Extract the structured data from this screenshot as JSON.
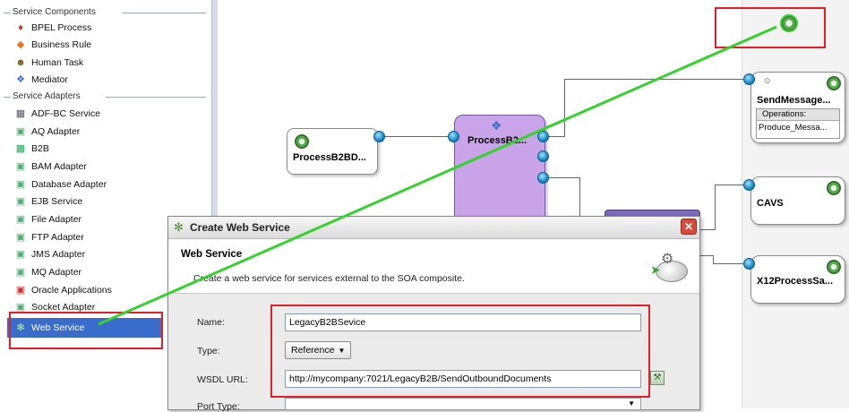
{
  "palette": {
    "service_components_header": "Service Components",
    "service_adapters_header": "Service Adapters",
    "components": [
      {
        "label": "BPEL Process",
        "icon": "bpel-icon"
      },
      {
        "label": "Business Rule",
        "icon": "business-rule-icon"
      },
      {
        "label": "Human Task",
        "icon": "human-task-icon"
      },
      {
        "label": "Mediator",
        "icon": "mediator-icon"
      }
    ],
    "adapters": [
      {
        "label": "ADF-BC Service",
        "icon": "adf-bc-icon"
      },
      {
        "label": "AQ Adapter",
        "icon": "aq-adapter-icon"
      },
      {
        "label": "B2B",
        "icon": "b2b-icon"
      },
      {
        "label": "BAM Adapter",
        "icon": "bam-adapter-icon"
      },
      {
        "label": "Database Adapter",
        "icon": "database-adapter-icon"
      },
      {
        "label": "EJB Service",
        "icon": "ejb-service-icon"
      },
      {
        "label": "File Adapter",
        "icon": "file-adapter-icon"
      },
      {
        "label": "FTP Adapter",
        "icon": "ftp-adapter-icon"
      },
      {
        "label": "JMS Adapter",
        "icon": "jms-adapter-icon"
      },
      {
        "label": "MQ Adapter",
        "icon": "mq-adapter-icon"
      },
      {
        "label": "Oracle Applications",
        "icon": "oracle-apps-icon"
      },
      {
        "label": "Socket Adapter",
        "icon": "socket-adapter-icon"
      },
      {
        "label": "Web Service",
        "icon": "web-service-icon"
      }
    ]
  },
  "canvas": {
    "process_b2bd_label": "ProcessB2BD...",
    "process_b2_label": "ProcessB2...",
    "send_message_label": "SendMessage...",
    "operations_label": "Operations:",
    "operation_value": "Produce_Messa...",
    "cavs_label": "CAVS",
    "x12_label": "X12ProcessSa..."
  },
  "dialog": {
    "title": "Create Web Service",
    "heading": "Web Service",
    "description": "Create a web service for services external to the SOA composite.",
    "name_label": "Name:",
    "name_value": "LegacyB2BSevice",
    "type_label": "Type:",
    "type_value": "Reference",
    "wsdl_label": "WSDL URL:",
    "wsdl_value": "http://mycompany:7021/LegacyB2B/SendOutboundDocuments",
    "port_type_label": "Port Type:"
  },
  "colors": {
    "highlight": "#e31e24",
    "drag_line": "#36d12e",
    "selection": "#3a6ccc",
    "mediator_fill": "#c9a4e8"
  }
}
